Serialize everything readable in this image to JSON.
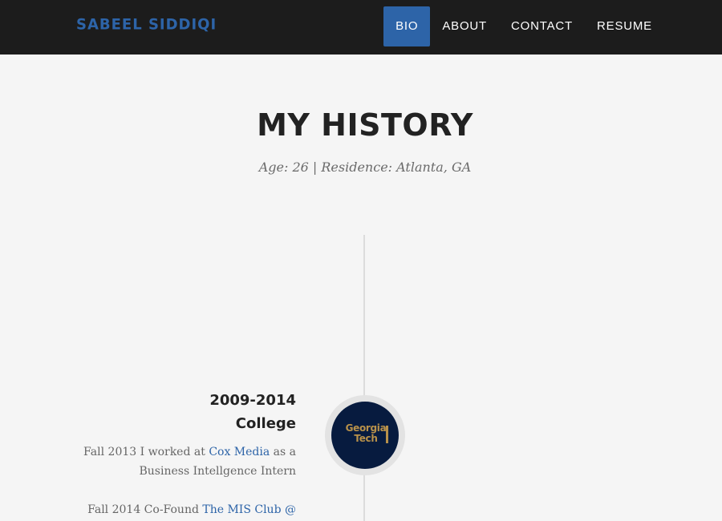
{
  "navbar": {
    "brand": "SABEEL SIDDIQI",
    "items": [
      {
        "label": "BIO",
        "active": true
      },
      {
        "label": "ABOUT",
        "active": false
      },
      {
        "label": "CONTACT",
        "active": false
      },
      {
        "label": "RESUME",
        "active": false
      }
    ],
    "accent_color": "#2d64a8",
    "background_color": "#1c1c1c"
  },
  "header": {
    "title": "MY HISTORY",
    "subtitle": "Age: 26 | Residence: Atlanta, GA"
  },
  "timeline": {
    "entries": [
      {
        "date": "2009-2014",
        "heading": "College",
        "image_logo_text": [
          "Georgia",
          "Tech"
        ],
        "paragraph1": {
          "before": "Fall 2013 I worked at ",
          "link": "Cox Media",
          "after": " as a Business Intellgence Intern"
        },
        "paragraph2": {
          "before": "Fall 2014 Co-Found ",
          "link": "The MIS Club @"
        }
      }
    ]
  }
}
